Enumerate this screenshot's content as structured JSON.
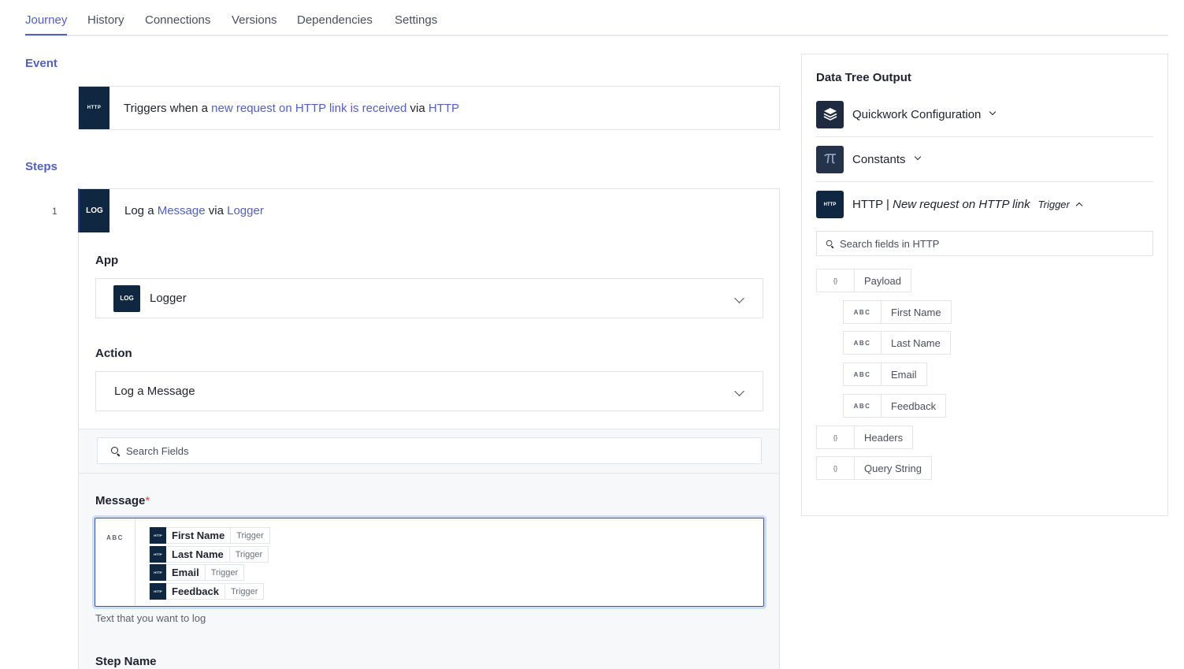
{
  "tabs": [
    {
      "label": "Journey",
      "active": true
    },
    {
      "label": "History"
    },
    {
      "label": "Connections"
    },
    {
      "label": "Versions"
    },
    {
      "label": "Dependencies"
    },
    {
      "label": "Settings"
    }
  ],
  "event": {
    "section_label": "Event",
    "logo_text": "HTTP",
    "prefix": "Triggers when a ",
    "trigger_link": "new request on HTTP link is received",
    "via": " via ",
    "app_link": "HTTP"
  },
  "steps": {
    "section_label": "Steps",
    "step_number": "1",
    "logo_text": "LOG",
    "prefix": "Log a ",
    "action_link": "Message",
    "via": " via ",
    "app_link": "Logger",
    "app_label": "App",
    "app_value": "Logger",
    "action_label": "Action",
    "action_value": "Log a Message",
    "search_placeholder": "Search Fields",
    "message_label": "Message",
    "required_mark": "*",
    "message_type": "ABC",
    "message_tokens": [
      {
        "name": "First Name",
        "tag": "Trigger"
      },
      {
        "name": "Last Name",
        "tag": "Trigger"
      },
      {
        "name": "Email",
        "tag": "Trigger"
      },
      {
        "name": "Feedback",
        "tag": "Trigger"
      }
    ],
    "message_help": "Text that you want to log",
    "step_name_label": "Step Name"
  },
  "data_tree": {
    "title": "Data Tree Output",
    "sources": [
      {
        "label": "Quickwork Configuration",
        "icon": "layers-icon"
      },
      {
        "label": "Constants",
        "icon": "pi-icon"
      }
    ],
    "http_source": {
      "logo_text": "HTTP",
      "prefix": "HTTP | ",
      "event": "New request on HTTP link",
      "tag": "Trigger"
    },
    "search_placeholder": "Search fields in HTTP",
    "nodes": [
      {
        "type": "{}",
        "label": "Payload"
      },
      {
        "type": "ABC",
        "label": "First Name"
      },
      {
        "type": "ABC",
        "label": "Last Name"
      },
      {
        "type": "ABC",
        "label": "Email"
      },
      {
        "type": "ABC",
        "label": "Feedback"
      },
      {
        "type": "{}",
        "label": "Headers"
      },
      {
        "type": "{}",
        "label": "Query String"
      }
    ]
  },
  "colors": {
    "accent": "#5260c6",
    "logo_bg": "#0f2740",
    "focus_border": "#3b56b0"
  }
}
